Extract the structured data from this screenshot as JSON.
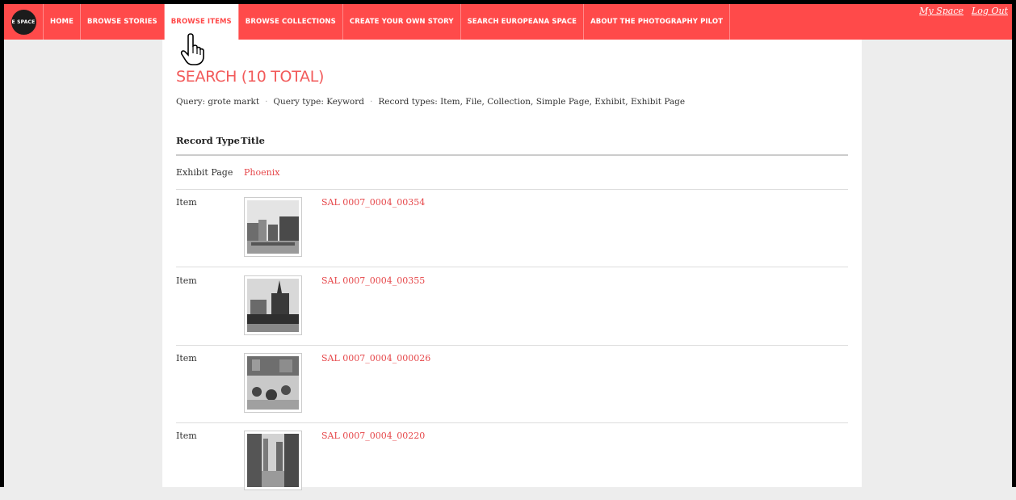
{
  "navbar": {
    "logo_text": "E SPACE",
    "items": [
      {
        "label": "HOME"
      },
      {
        "label": "BROWSE STORIES"
      },
      {
        "label": "BROWSE ITEMS"
      },
      {
        "label": "BROWSE COLLECTIONS"
      },
      {
        "label": "CREATE YOUR OWN STORY"
      },
      {
        "label": "SEARCH EUROPEANA SPACE"
      },
      {
        "label": "ABOUT THE PHOTOGRAPHY PILOT"
      }
    ],
    "user_links": {
      "my_space": "My Space",
      "log_out": "Log Out"
    }
  },
  "search": {
    "title": "SEARCH (10 TOTAL)",
    "query": "Query: grote markt",
    "query_type": "Query type: Keyword",
    "record_types": "Record types: Item, File, Collection, Simple Page, Exhibit, Exhibit Page",
    "separator": "·"
  },
  "table": {
    "headers": {
      "record_type": "Record Type",
      "title": "Title"
    },
    "rows": [
      {
        "type": "Exhibit Page",
        "title": "Phoenix",
        "thumb": "none"
      },
      {
        "type": "Item",
        "title": "SAL 0007_0004_00354",
        "thumb": "square-buildings-photo"
      },
      {
        "type": "Item",
        "title": "SAL 0007_0004_00355",
        "thumb": "church-tower-photo"
      },
      {
        "type": "Item",
        "title": "SAL 0007_0004_000026",
        "thumb": "cyclists-street-photo"
      },
      {
        "type": "Item",
        "title": "SAL 0007_0004_00220",
        "thumb": "street-facades-photo"
      }
    ]
  },
  "colors": {
    "accent": "#ff4a4a",
    "link": "#e6474a",
    "background": "#ededed"
  },
  "cursor": {
    "icon": "hand-pointer-icon"
  }
}
